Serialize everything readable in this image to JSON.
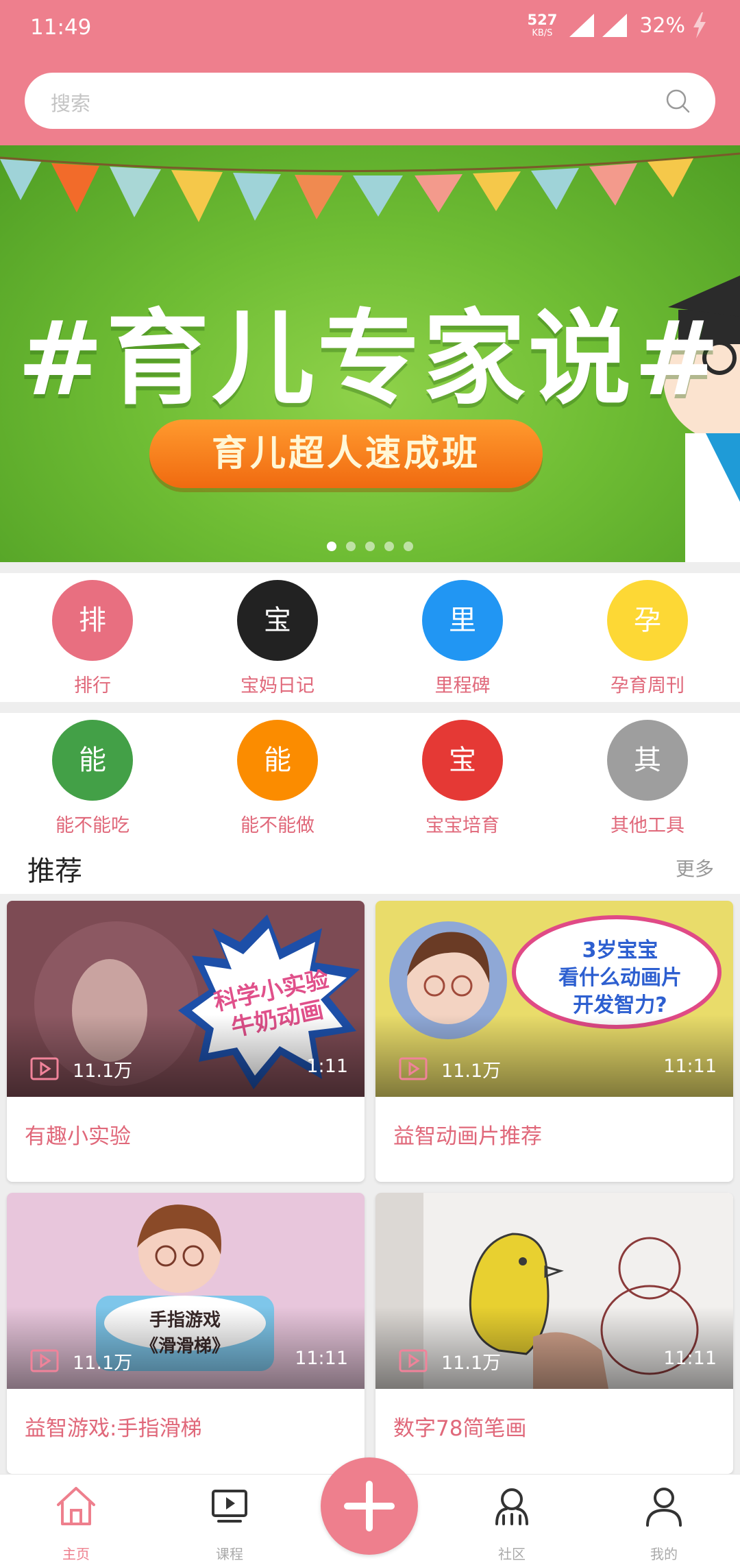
{
  "status_bar": {
    "time": "11:49",
    "net_speed": "527",
    "net_speed_unit": "KB/S",
    "battery": "32%",
    "icons": [
      "signal-icon",
      "signal-icon",
      "charging-icon"
    ]
  },
  "search": {
    "placeholder": "搜索",
    "icon": "search-icon"
  },
  "banner": {
    "title": "#育儿专家说#",
    "subtitle": "育儿超人速成班",
    "dot_count": 5,
    "active_dot": 0
  },
  "quick_grid": [
    {
      "glyph": "排",
      "label": "排行",
      "color": "#e86f80"
    },
    {
      "glyph": "宝",
      "label": "宝妈日记",
      "color": "#222222"
    },
    {
      "glyph": "里",
      "label": "里程碑",
      "color": "#2196f3"
    },
    {
      "glyph": "孕",
      "label": "孕育周刊",
      "color": "#fdd835"
    },
    {
      "glyph": "能",
      "label": "能不能吃",
      "color": "#43a047"
    },
    {
      "glyph": "能",
      "label": "能不能做",
      "color": "#fb8c00"
    },
    {
      "glyph": "宝",
      "label": "宝宝培育",
      "color": "#e53935"
    },
    {
      "glyph": "其",
      "label": "其他工具",
      "color": "#9e9e9e"
    }
  ],
  "recommend": {
    "title": "推荐",
    "more": "更多",
    "cards": [
      {
        "title": "有趣小实验",
        "views": "11.1万",
        "duration": "1:11",
        "thumb_text": "科学小实验 牛奶动画"
      },
      {
        "title": "益智动画片推荐",
        "views": "11.1万",
        "duration": "11:11",
        "thumb_text": "3岁宝宝 看什么动画片 开发智力?"
      },
      {
        "title": "益智游戏:手指滑梯",
        "views": "11.1万",
        "duration": "11:11",
        "thumb_text": "手指游戏 《滑滑梯》"
      },
      {
        "title": "数字78简笔画",
        "views": "11.1万",
        "duration": "11:11",
        "thumb_text": ""
      }
    ]
  },
  "bottom_nav": {
    "items": [
      {
        "label": "主页",
        "icon": "home-icon",
        "active": true
      },
      {
        "label": "课程",
        "icon": "video-icon",
        "active": false
      },
      {
        "label": "社区",
        "icon": "community-icon",
        "active": false
      },
      {
        "label": "我的",
        "icon": "profile-icon",
        "active": false
      }
    ],
    "fab_icon": "plus-icon"
  }
}
